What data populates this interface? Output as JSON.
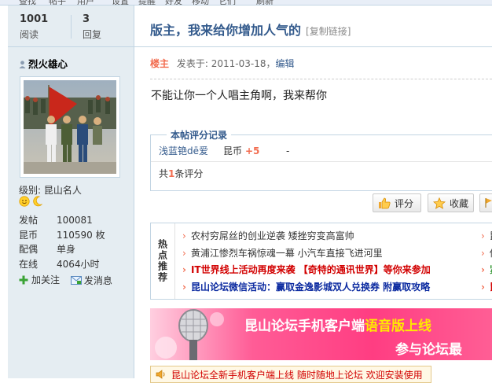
{
  "nav": {
    "items": [
      "查找",
      "帖子",
      "用户",
      "设置",
      "提醒",
      "好友",
      "移动",
      "它们",
      "刷新"
    ]
  },
  "stats": {
    "views": "1001",
    "views_label": "阅读",
    "replies": "3",
    "replies_label": "回复"
  },
  "author": {
    "name": "烈火雄心",
    "level_label": "级别:",
    "level": "昆山名人",
    "info": [
      {
        "key": "发帖",
        "value": "100081"
      },
      {
        "key": "昆币",
        "value": "110590 枚"
      },
      {
        "key": "配偶",
        "value": "单身"
      },
      {
        "key": "在线",
        "value": "4064小时"
      }
    ],
    "follow_label": "加关注",
    "message_label": "发消息"
  },
  "thread": {
    "title": "版主，我来给你增加人气的",
    "copy_link": "[复制链接]"
  },
  "post": {
    "floor": "楼主",
    "posted_label": "发表于:",
    "date": "2011-03-18",
    "sep": "，",
    "edit": "编辑",
    "content": "不能让你一个人唱主角啊，我来帮你"
  },
  "rating": {
    "legend": "本帖评分记录",
    "rows": [
      {
        "user": "浅蓝铯dē爱",
        "currency": "昆币",
        "score": "+5",
        "reason": "-"
      }
    ],
    "sum_prefix": "共",
    "sum_count": "1",
    "sum_suffix": "条评分"
  },
  "buttons": {
    "rate": "评分",
    "favorite": "收藏"
  },
  "hot": {
    "label": "热点推荐",
    "items": [
      "农村穷屌丝的创业逆袭 矮挫穷变高富帅",
      "黄浦江惨烈车祸惊魂一幕 小汽车直接飞进河里",
      "IT世界线上活动再度来袭 【奇特的通讯世界】等你来参加",
      "昆山论坛微信活动：赢取金逸影城双人兑换券 附赢取攻略"
    ],
    "right_items": [
      "昆",
      "伤",
      "紧",
      "昆"
    ],
    "arrow": "›"
  },
  "banner": {
    "line1_white": "昆山论坛手机客户端",
    "line1_yellow": "语音版上线",
    "line2": "参与论坛最"
  },
  "notice": {
    "text": "昆山论坛全新手机客户端上线 随时随地上论坛 欢迎安装使用"
  },
  "colors": {
    "sidebar_bg": "#e5edf2",
    "border": "#c2d5e3",
    "title_blue": "#335a8c",
    "accent_orange": "#f26c4f",
    "hot_red": "#d20000",
    "hot_blue": "#0b2aa0",
    "banner_pink": "#ff3d82"
  }
}
